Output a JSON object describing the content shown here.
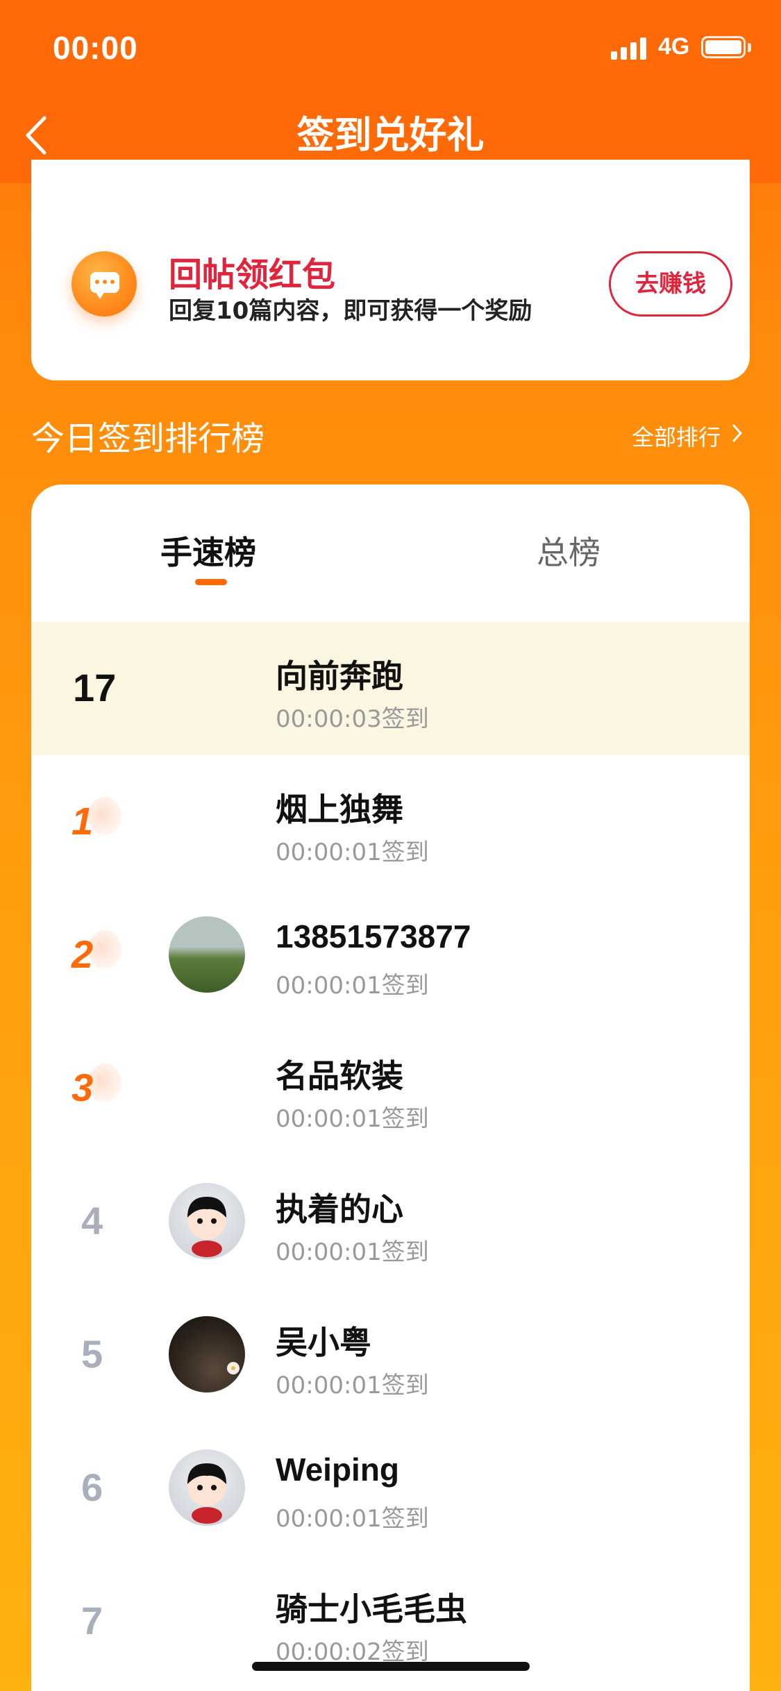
{
  "status_bar": {
    "time": "00:00",
    "network": "4G"
  },
  "header": {
    "title": "签到兑好礼"
  },
  "promo": {
    "title": "回帖领红包",
    "description": "回复10篇内容，即可获得一个奖励",
    "button": "去赚钱"
  },
  "ranking": {
    "heading": "今日签到排行榜",
    "all_link": "全部排行",
    "tabs": [
      "手速榜",
      "总榜"
    ],
    "selected_tab": "手速榜",
    "my_row": {
      "rank": "17",
      "name": "向前奔跑",
      "time": "00:00:03签到"
    },
    "rows": [
      {
        "rank": "1",
        "name": "烟上独舞",
        "time": "00:00:01签到"
      },
      {
        "rank": "2",
        "name": "13851573877",
        "time": "00:00:01签到"
      },
      {
        "rank": "3",
        "name": "名品软装",
        "time": "00:00:01签到"
      },
      {
        "rank": "4",
        "name": "执着的心",
        "time": "00:00:01签到"
      },
      {
        "rank": "5",
        "name": "吴小粤",
        "time": "00:00:01签到"
      },
      {
        "rank": "6",
        "name": "Weiping",
        "time": "00:00:01签到"
      },
      {
        "rank": "7",
        "name": "骑士小毛毛虫",
        "time": "00:00:02签到"
      }
    ]
  },
  "colors": {
    "header": "#FF6A09",
    "accent": "#E0243B",
    "medal": "#FF6A09"
  }
}
